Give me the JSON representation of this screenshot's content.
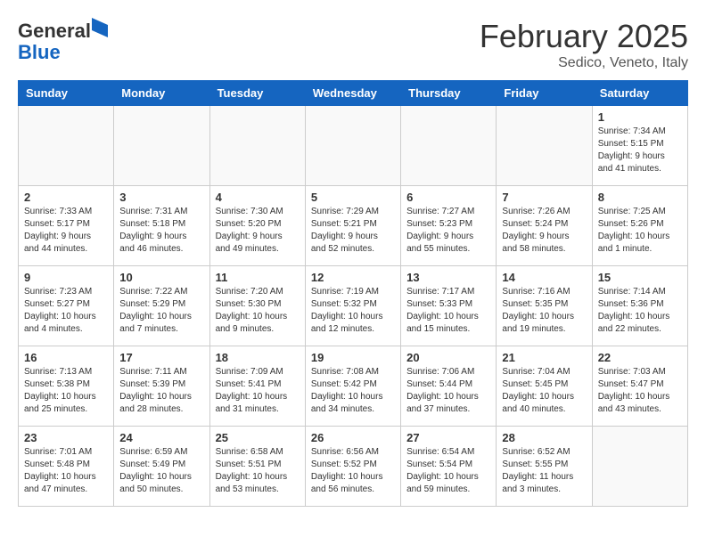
{
  "header": {
    "logo": {
      "general": "General",
      "blue": "Blue"
    },
    "title": "February 2025",
    "subtitle": "Sedico, Veneto, Italy"
  },
  "calendar": {
    "weekdays": [
      "Sunday",
      "Monday",
      "Tuesday",
      "Wednesday",
      "Thursday",
      "Friday",
      "Saturday"
    ],
    "weeks": [
      [
        {
          "day": "",
          "info": ""
        },
        {
          "day": "",
          "info": ""
        },
        {
          "day": "",
          "info": ""
        },
        {
          "day": "",
          "info": ""
        },
        {
          "day": "",
          "info": ""
        },
        {
          "day": "",
          "info": ""
        },
        {
          "day": "1",
          "info": "Sunrise: 7:34 AM\nSunset: 5:15 PM\nDaylight: 9 hours and 41 minutes."
        }
      ],
      [
        {
          "day": "2",
          "info": "Sunrise: 7:33 AM\nSunset: 5:17 PM\nDaylight: 9 hours and 44 minutes."
        },
        {
          "day": "3",
          "info": "Sunrise: 7:31 AM\nSunset: 5:18 PM\nDaylight: 9 hours and 46 minutes."
        },
        {
          "day": "4",
          "info": "Sunrise: 7:30 AM\nSunset: 5:20 PM\nDaylight: 9 hours and 49 minutes."
        },
        {
          "day": "5",
          "info": "Sunrise: 7:29 AM\nSunset: 5:21 PM\nDaylight: 9 hours and 52 minutes."
        },
        {
          "day": "6",
          "info": "Sunrise: 7:27 AM\nSunset: 5:23 PM\nDaylight: 9 hours and 55 minutes."
        },
        {
          "day": "7",
          "info": "Sunrise: 7:26 AM\nSunset: 5:24 PM\nDaylight: 9 hours and 58 minutes."
        },
        {
          "day": "8",
          "info": "Sunrise: 7:25 AM\nSunset: 5:26 PM\nDaylight: 10 hours and 1 minute."
        }
      ],
      [
        {
          "day": "9",
          "info": "Sunrise: 7:23 AM\nSunset: 5:27 PM\nDaylight: 10 hours and 4 minutes."
        },
        {
          "day": "10",
          "info": "Sunrise: 7:22 AM\nSunset: 5:29 PM\nDaylight: 10 hours and 7 minutes."
        },
        {
          "day": "11",
          "info": "Sunrise: 7:20 AM\nSunset: 5:30 PM\nDaylight: 10 hours and 9 minutes."
        },
        {
          "day": "12",
          "info": "Sunrise: 7:19 AM\nSunset: 5:32 PM\nDaylight: 10 hours and 12 minutes."
        },
        {
          "day": "13",
          "info": "Sunrise: 7:17 AM\nSunset: 5:33 PM\nDaylight: 10 hours and 15 minutes."
        },
        {
          "day": "14",
          "info": "Sunrise: 7:16 AM\nSunset: 5:35 PM\nDaylight: 10 hours and 19 minutes."
        },
        {
          "day": "15",
          "info": "Sunrise: 7:14 AM\nSunset: 5:36 PM\nDaylight: 10 hours and 22 minutes."
        }
      ],
      [
        {
          "day": "16",
          "info": "Sunrise: 7:13 AM\nSunset: 5:38 PM\nDaylight: 10 hours and 25 minutes."
        },
        {
          "day": "17",
          "info": "Sunrise: 7:11 AM\nSunset: 5:39 PM\nDaylight: 10 hours and 28 minutes."
        },
        {
          "day": "18",
          "info": "Sunrise: 7:09 AM\nSunset: 5:41 PM\nDaylight: 10 hours and 31 minutes."
        },
        {
          "day": "19",
          "info": "Sunrise: 7:08 AM\nSunset: 5:42 PM\nDaylight: 10 hours and 34 minutes."
        },
        {
          "day": "20",
          "info": "Sunrise: 7:06 AM\nSunset: 5:44 PM\nDaylight: 10 hours and 37 minutes."
        },
        {
          "day": "21",
          "info": "Sunrise: 7:04 AM\nSunset: 5:45 PM\nDaylight: 10 hours and 40 minutes."
        },
        {
          "day": "22",
          "info": "Sunrise: 7:03 AM\nSunset: 5:47 PM\nDaylight: 10 hours and 43 minutes."
        }
      ],
      [
        {
          "day": "23",
          "info": "Sunrise: 7:01 AM\nSunset: 5:48 PM\nDaylight: 10 hours and 47 minutes."
        },
        {
          "day": "24",
          "info": "Sunrise: 6:59 AM\nSunset: 5:49 PM\nDaylight: 10 hours and 50 minutes."
        },
        {
          "day": "25",
          "info": "Sunrise: 6:58 AM\nSunset: 5:51 PM\nDaylight: 10 hours and 53 minutes."
        },
        {
          "day": "26",
          "info": "Sunrise: 6:56 AM\nSunset: 5:52 PM\nDaylight: 10 hours and 56 minutes."
        },
        {
          "day": "27",
          "info": "Sunrise: 6:54 AM\nSunset: 5:54 PM\nDaylight: 10 hours and 59 minutes."
        },
        {
          "day": "28",
          "info": "Sunrise: 6:52 AM\nSunset: 5:55 PM\nDaylight: 11 hours and 3 minutes."
        },
        {
          "day": "",
          "info": ""
        }
      ]
    ]
  }
}
